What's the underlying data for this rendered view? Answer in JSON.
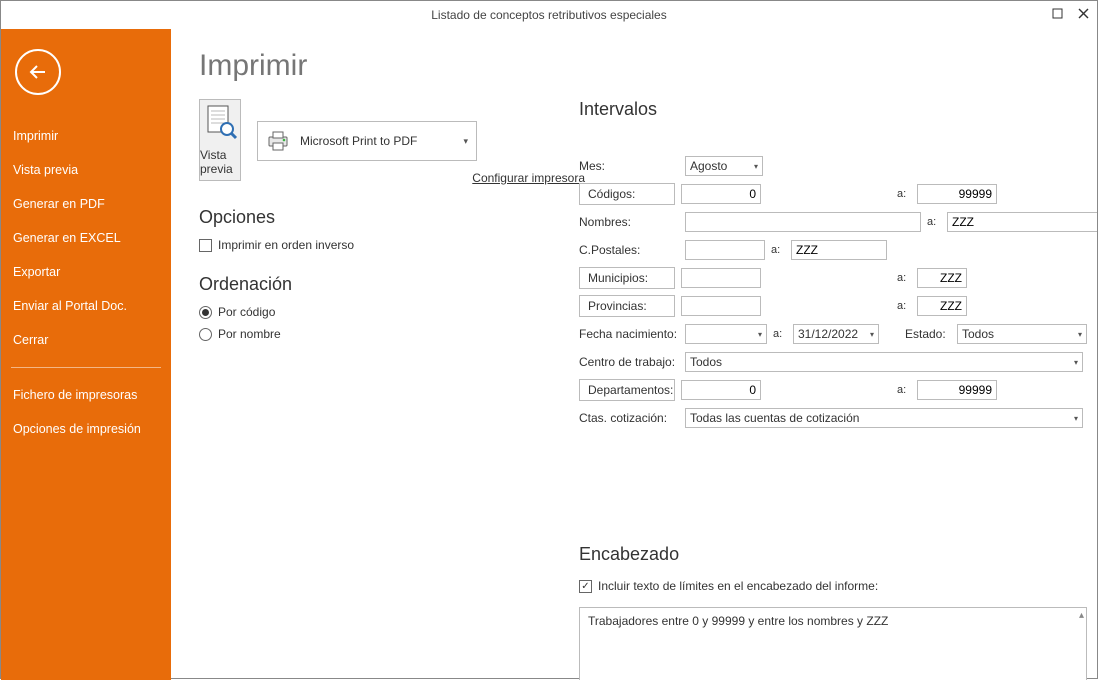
{
  "window": {
    "title": "Listado de conceptos retributivos especiales"
  },
  "sidebar": {
    "items": [
      "Imprimir",
      "Vista previa",
      "Generar en PDF",
      "Generar en EXCEL",
      "Exportar",
      "Enviar al Portal Doc.",
      "Cerrar"
    ],
    "items2": [
      "Fichero de impresoras",
      "Opciones de impresión"
    ]
  },
  "page": {
    "title": "Imprimir",
    "preview_label": "Vista previa",
    "printer": "Microsoft Print to PDF",
    "config_printer": "Configurar impresora",
    "opciones_title": "Opciones",
    "reverse_label": "Imprimir en orden inverso",
    "ordenacion_title": "Ordenación",
    "radio_codigo": "Por código",
    "radio_nombre": "Por nombre"
  },
  "intervalos": {
    "title": "Intervalos",
    "mes_label": "Mes:",
    "mes_value": "Agosto",
    "codigos_label": "Códigos:",
    "codigos_from": "0",
    "a": "a:",
    "codigos_to": "99999",
    "nombres_label": "Nombres:",
    "nombres_from": "",
    "nombres_to": "ZZZ",
    "cpostales_label": "C.Postales:",
    "cpostales_from": "",
    "cpostales_to": "ZZZ",
    "municipios_label": "Municipios:",
    "municipios_from": "",
    "municipios_to": "ZZZ",
    "provincias_label": "Provincias:",
    "provincias_from": "",
    "provincias_to": "ZZZ",
    "fnac_label": "Fecha nacimiento:",
    "fnac_from": "",
    "fnac_to": "31/12/2022",
    "estado_label": "Estado:",
    "estado_value": "Todos",
    "centro_label": "Centro de trabajo:",
    "centro_value": "Todos",
    "departamentos_label": "Departamentos:",
    "dept_from": "0",
    "dept_to": "99999",
    "ctas_label": "Ctas. cotización:",
    "ctas_value": "Todas las cuentas de cotización"
  },
  "encabezado": {
    "title": "Encabezado",
    "check_label": "Incluir texto de límites en el encabezado del informe:",
    "text": "Trabajadores entre 0 y 99999 y entre los nombres  y ZZZ"
  }
}
